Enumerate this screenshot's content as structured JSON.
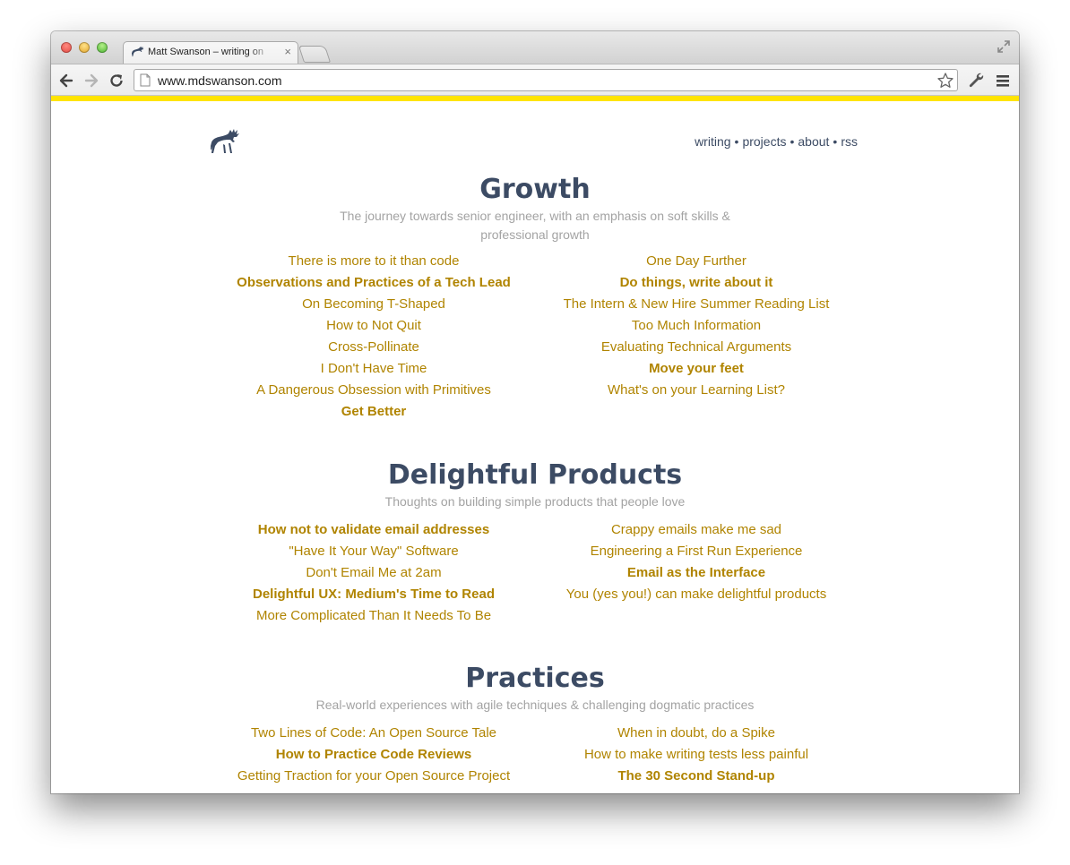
{
  "browser": {
    "tab": {
      "title": "Matt Swanson – writing on"
    },
    "address": "www.mdswanson.com",
    "colors": {
      "accent_bar": "#ffe400"
    }
  },
  "header": {
    "logo_icon": "moose-icon",
    "nav": [
      {
        "label": "writing"
      },
      {
        "label": "projects"
      },
      {
        "label": "about"
      },
      {
        "label": "rss"
      }
    ],
    "nav_separator": "•"
  },
  "sections": [
    {
      "title": "Growth",
      "description": "The journey towards senior engineer, with an emphasis on soft skills & professional growth",
      "left": [
        {
          "label": "There is more to it than code",
          "bold": false
        },
        {
          "label": "Observations and Practices of a Tech Lead",
          "bold": true
        },
        {
          "label": "On Becoming T-Shaped",
          "bold": false
        },
        {
          "label": "How to Not Quit",
          "bold": false
        },
        {
          "label": "Cross-Pollinate",
          "bold": false
        },
        {
          "label": "I Don't Have Time",
          "bold": false
        },
        {
          "label": "A Dangerous Obsession with Primitives",
          "bold": false
        },
        {
          "label": "Get Better",
          "bold": true
        }
      ],
      "right": [
        {
          "label": "One Day Further",
          "bold": false
        },
        {
          "label": "Do things, write about it",
          "bold": true
        },
        {
          "label": "The Intern & New Hire Summer Reading List",
          "bold": false
        },
        {
          "label": "Too Much Information",
          "bold": false
        },
        {
          "label": "Evaluating Technical Arguments",
          "bold": false
        },
        {
          "label": "Move your feet",
          "bold": true
        },
        {
          "label": "What's on your Learning List?",
          "bold": false
        }
      ]
    },
    {
      "title": "Delightful Products",
      "description": "Thoughts on building simple products that people love",
      "left": [
        {
          "label": "How not to validate email addresses",
          "bold": true
        },
        {
          "label": "\"Have It Your Way\" Software",
          "bold": false
        },
        {
          "label": "Don't Email Me at 2am",
          "bold": false
        },
        {
          "label": "Delightful UX: Medium's Time to Read",
          "bold": true
        },
        {
          "label": "More Complicated Than It Needs To Be",
          "bold": false
        }
      ],
      "right": [
        {
          "label": "Crappy emails make me sad",
          "bold": false
        },
        {
          "label": "Engineering a First Run Experience",
          "bold": false
        },
        {
          "label": "Email as the Interface",
          "bold": true
        },
        {
          "label": "You (yes you!) can make delightful products",
          "bold": false
        }
      ]
    },
    {
      "title": "Practices",
      "description": "Real-world experiences with agile techniques & challenging dogmatic practices",
      "left": [
        {
          "label": "Two Lines of Code: An Open Source Tale",
          "bold": false
        },
        {
          "label": "How to Practice Code Reviews",
          "bold": true
        },
        {
          "label": "Getting Traction for your Open Source Project",
          "bold": false
        }
      ],
      "right": [
        {
          "label": "When in doubt, do a Spike",
          "bold": false
        },
        {
          "label": "How to make writing tests less painful",
          "bold": false
        },
        {
          "label": "The 30 Second Stand-up",
          "bold": true
        }
      ]
    }
  ],
  "colors": {
    "heading": "#3c4b64",
    "link": "#b08400",
    "description": "#a3a3a3"
  }
}
